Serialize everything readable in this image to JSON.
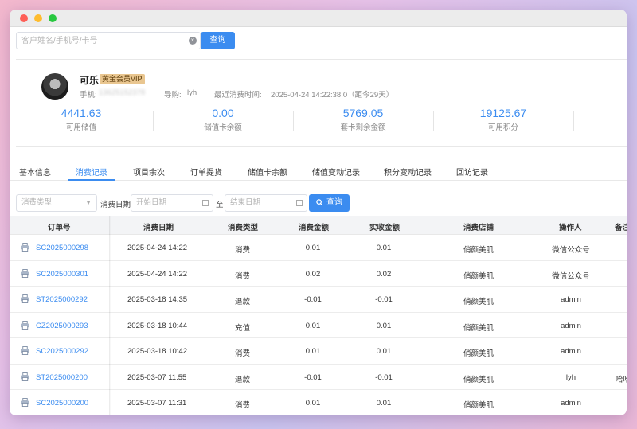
{
  "search": {
    "placeholder": "客户姓名/手机号/卡号",
    "clear_glyph": "×",
    "button": "查询"
  },
  "customer": {
    "name": "可乐",
    "badge": "黄金会员VIP",
    "phone_label": "手机:",
    "phone_value": "13625152378",
    "guide_label": "导购:",
    "guide_value": "lyh",
    "last_visit_label": "最近消费时间:",
    "last_visit_value": "2025-04-24 14:22:38.0（距今29天）"
  },
  "stats": [
    {
      "value": "4441.63",
      "label": "可用储值"
    },
    {
      "value": "0.00",
      "label": "储值卡余额"
    },
    {
      "value": "5769.05",
      "label": "套卡剩余金额"
    },
    {
      "value": "19125.67",
      "label": "可用积分"
    }
  ],
  "tabs": [
    "基本信息",
    "消费记录",
    "项目余次",
    "订单提货",
    "储值卡余额",
    "储值变动记录",
    "积分变动记录",
    "回访记录"
  ],
  "active_tab": "消费记录",
  "filters": {
    "type_placeholder": "消费类型",
    "date_label": "消费日期",
    "start_placeholder": "开始日期",
    "to_label": "至",
    "end_placeholder": "结束日期",
    "query_button": "查询"
  },
  "table": {
    "headers": [
      "订单号",
      "消费日期",
      "消费类型",
      "消费金额",
      "实收金额",
      "消费店铺",
      "操作人",
      "备注"
    ],
    "rows": [
      {
        "order": "SC2025000298",
        "date": "2025-04-24 14:22",
        "type": "消费",
        "amount": "0.01",
        "received": "0.01",
        "store": "俏颜美肌",
        "operator": "微信公众号",
        "note": ""
      },
      {
        "order": "SC2025000301",
        "date": "2025-04-24 14:22",
        "type": "消费",
        "amount": "0.02",
        "received": "0.02",
        "store": "俏颜美肌",
        "operator": "微信公众号",
        "note": ""
      },
      {
        "order": "ST2025000292",
        "date": "2025-03-18 14:35",
        "type": "退款",
        "amount": "-0.01",
        "received": "-0.01",
        "store": "俏颜美肌",
        "operator": "admin",
        "note": ""
      },
      {
        "order": "CZ2025000293",
        "date": "2025-03-18 10:44",
        "type": "充值",
        "amount": "0.01",
        "received": "0.01",
        "store": "俏颜美肌",
        "operator": "admin",
        "note": ""
      },
      {
        "order": "SC2025000292",
        "date": "2025-03-18 10:42",
        "type": "消费",
        "amount": "0.01",
        "received": "0.01",
        "store": "俏颜美肌",
        "operator": "admin",
        "note": ""
      },
      {
        "order": "ST2025000200",
        "date": "2025-03-07 11:55",
        "type": "退款",
        "amount": "-0.01",
        "received": "-0.01",
        "store": "俏颜美肌",
        "operator": "lyh",
        "note": "哈哈"
      },
      {
        "order": "SC2025000200",
        "date": "2025-03-07 11:31",
        "type": "消费",
        "amount": "0.01",
        "received": "0.01",
        "store": "俏颜美肌",
        "operator": "admin",
        "note": ""
      }
    ]
  },
  "colors": {
    "accent": "#3b8cf0",
    "vip_badge": "#e9c690"
  }
}
